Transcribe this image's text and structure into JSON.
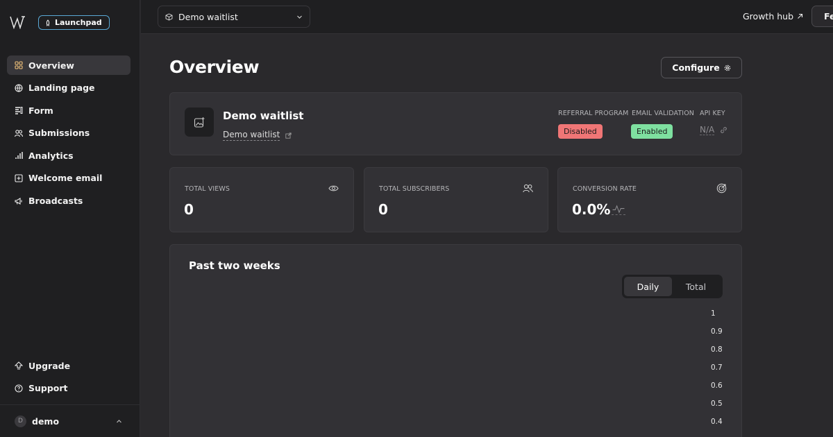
{
  "sidebar": {
    "badge_label": "Launchpad",
    "items": [
      {
        "label": "Overview",
        "icon": "grid-icon"
      },
      {
        "label": "Landing page",
        "icon": "globe-icon"
      },
      {
        "label": "Form",
        "icon": "form-icon"
      },
      {
        "label": "Submissions",
        "icon": "users-icon"
      },
      {
        "label": "Analytics",
        "icon": "bar-chart-icon"
      },
      {
        "label": "Welcome email",
        "icon": "plus-square-icon"
      },
      {
        "label": "Broadcasts",
        "icon": "megaphone-icon"
      }
    ],
    "bottom_items": [
      {
        "label": "Upgrade",
        "icon": "upgrade-icon"
      },
      {
        "label": "Support",
        "icon": "help-icon"
      }
    ],
    "user": {
      "initial": "D",
      "name": "demo"
    }
  },
  "topbar": {
    "selected_waitlist": "Demo waitlist",
    "growth_hub_label": "Growth hub",
    "fe_button_label": "Fe"
  },
  "main": {
    "title": "Overview",
    "configure_label": "Configure",
    "waitlist": {
      "name": "Demo waitlist",
      "link_text": "Demo waitlist",
      "referral_label": "REFERRAL PROGRAM",
      "referral_status": "Disabled",
      "email_label": "EMAIL VALIDATION",
      "email_status": "Enabled",
      "api_label": "API KEY",
      "api_value": "N/A"
    },
    "stats": [
      {
        "label": "TOTAL VIEWS",
        "value": "0",
        "icon": "eye-icon"
      },
      {
        "label": "TOTAL SUBSCRIBERS",
        "value": "0",
        "icon": "users-icon"
      },
      {
        "label": "CONVERSION RATE",
        "value": "0.0%",
        "icon": "target-icon"
      }
    ],
    "chart": {
      "title": "Past two weeks",
      "toggle": {
        "daily": "Daily",
        "total": "Total",
        "active": "Daily"
      },
      "yticks": [
        "1",
        "0.9",
        "0.8",
        "0.7",
        "0.6",
        "0.5",
        "0.4"
      ]
    }
  },
  "colors": {
    "disabled_badge": "#f07676",
    "enabled_badge": "#7ee0a0",
    "launchpad_border": "#5aa9d6"
  }
}
